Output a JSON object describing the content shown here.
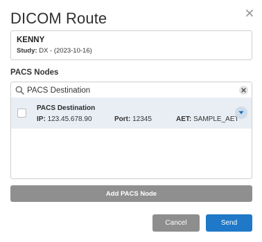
{
  "dialog": {
    "title": "DICOM Route"
  },
  "patient": {
    "name": "KENNY",
    "study_label": "Study:",
    "study_value": "DX - (2023-10-16)"
  },
  "pacs": {
    "section_label": "PACS Nodes",
    "search_value": "PACS Destination",
    "nodes": [
      {
        "name": "PACS Destination",
        "ip_label": "IP:",
        "ip": "123.45.678.90",
        "port_label": "Port:",
        "port": "12345",
        "aet_label": "AET:",
        "aet": "SAMPLE_AET",
        "selected": false
      }
    ],
    "add_label": "Add PACS Node"
  },
  "actions": {
    "cancel_label": "Cancel",
    "send_label": "Send"
  },
  "colors": {
    "primary": "#1f79c8",
    "secondary_button": "#8e8e8e",
    "selected_row": "#e9eef4"
  },
  "icons": {
    "close": "close-icon",
    "search": "search-icon",
    "clear": "clear-icon",
    "expand": "chevron-down-icon"
  }
}
